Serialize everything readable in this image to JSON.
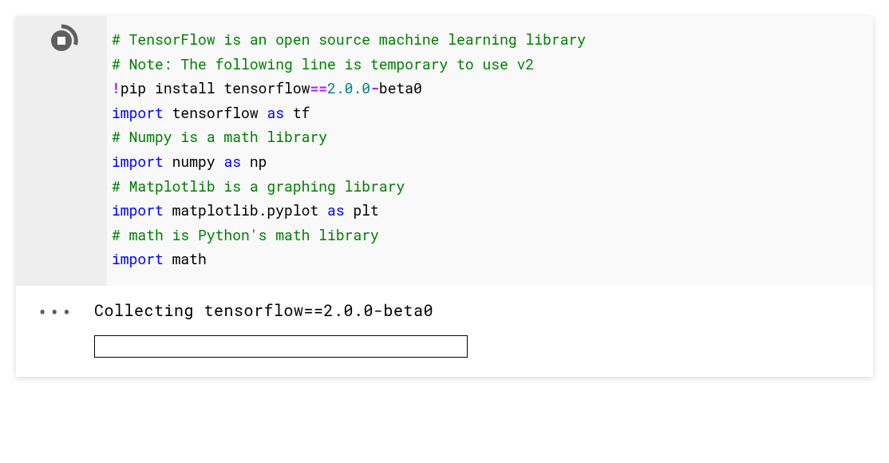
{
  "code": {
    "line1_comment": "# TensorFlow is an open source machine learning library",
    "line2_comment": "# Note: The following line is temporary to use v2",
    "line3_bang": "!",
    "line3_pip": "pip install tensorflow",
    "line3_eq": "==",
    "line3_ver": "2.0.0",
    "line3_suffix": "-beta0",
    "line4_import": "import",
    "line4_mod": " tensorflow ",
    "line4_as": "as",
    "line4_alias": " tf",
    "line5_comment": "# Numpy is a math library",
    "line6_import": "import",
    "line6_mod": " numpy ",
    "line6_as": "as",
    "line6_alias": " np",
    "line7_comment": "# Matplotlib is a graphing library",
    "line8_import": "import",
    "line8_mod": " matplotlib.pyplot ",
    "line8_as": "as",
    "line8_alias": " plt",
    "line9_comment": "# math is Python's math library",
    "line10_import": "import",
    "line10_mod": " math"
  },
  "output": {
    "dots": "•••",
    "collecting": "Collecting tensorflow==2.0.0-beta0"
  }
}
